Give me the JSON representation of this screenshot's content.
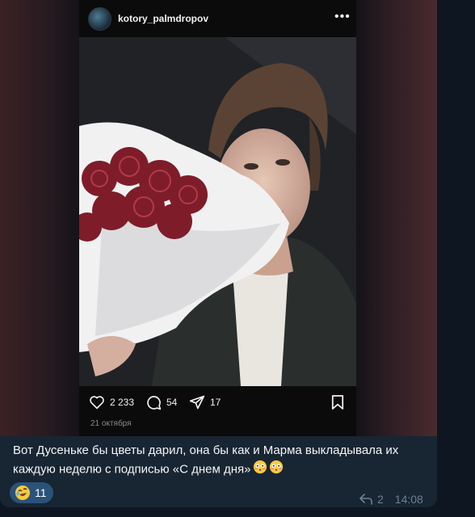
{
  "post": {
    "username": "kotory_palmdropov",
    "more_icon": "more-horizontal-icon",
    "likes": "2 233",
    "comments": "54",
    "shares": "17",
    "date": "21 октября"
  },
  "message": {
    "caption": "Вот Дусеньке бы цветы дарил, она бы как и Марма выкладывала их каждую неделю с подписью «С днем дня»",
    "reaction_count": "11",
    "forward_count": "2",
    "time": "14:08"
  },
  "colors": {
    "chat_background": "#0e1621",
    "bubble": "#182533",
    "reaction_pill": "#2b5278",
    "meta_text": "#6d8191"
  }
}
